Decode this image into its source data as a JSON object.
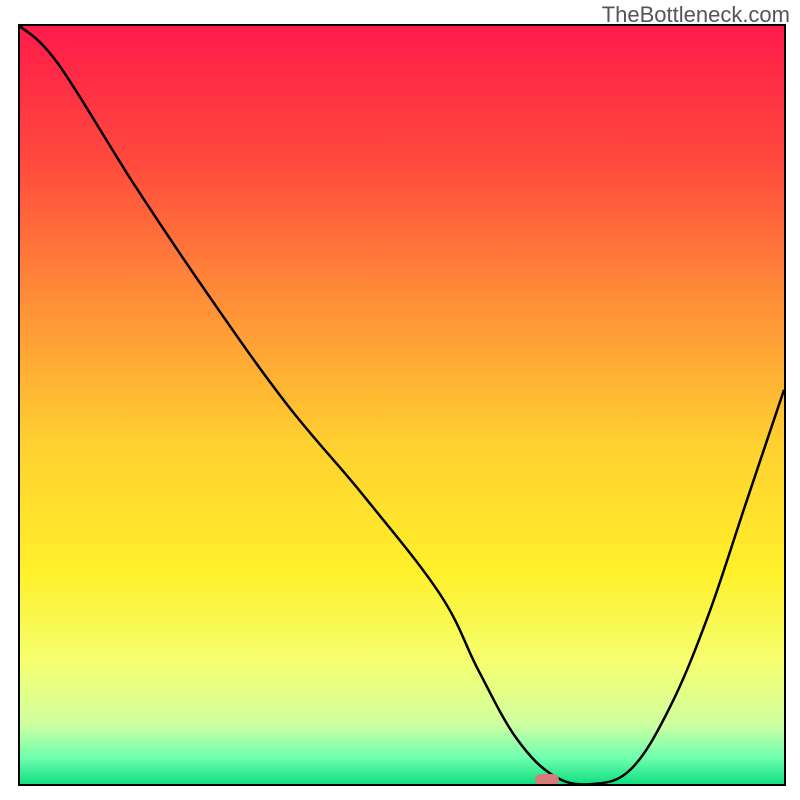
{
  "watermark": "TheBottleneck.com",
  "chart_data": {
    "type": "line",
    "title": "",
    "xlabel": "",
    "ylabel": "",
    "xlim": [
      0,
      100
    ],
    "ylim": [
      0,
      100
    ],
    "x": [
      0,
      5,
      15,
      25,
      35,
      45,
      55,
      60,
      65,
      70,
      75,
      80,
      85,
      90,
      95,
      100
    ],
    "y": [
      100,
      95,
      79,
      64,
      50,
      38,
      25,
      15,
      6,
      1,
      0,
      2,
      10,
      22,
      37,
      52
    ],
    "marker": {
      "x": 69,
      "y": 0.5
    },
    "gradient_stops": [
      {
        "pos": 0.0,
        "color": "#ff1a4a"
      },
      {
        "pos": 0.18,
        "color": "#ff4a3d"
      },
      {
        "pos": 0.35,
        "color": "#ff8a38"
      },
      {
        "pos": 0.55,
        "color": "#ffd030"
      },
      {
        "pos": 0.72,
        "color": "#fff02a"
      },
      {
        "pos": 0.84,
        "color": "#f5ff70"
      },
      {
        "pos": 0.92,
        "color": "#d0ffa0"
      },
      {
        "pos": 0.965,
        "color": "#70ffb0"
      },
      {
        "pos": 1.0,
        "color": "#10e080"
      }
    ]
  }
}
